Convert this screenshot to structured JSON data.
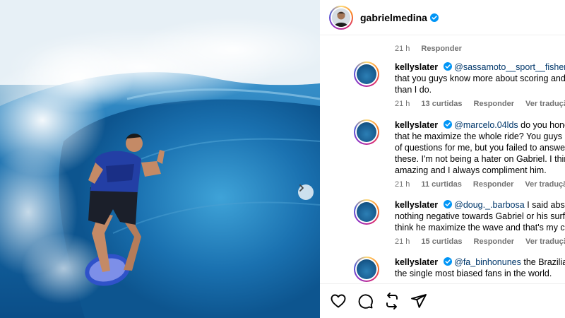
{
  "post": {
    "username": "gabrielmedina",
    "verified": true
  },
  "carousel": {
    "next_icon": "chevron-right-icon"
  },
  "top_comment_meta": {
    "time": "21 h",
    "reply": "Responder"
  },
  "comments": [
    {
      "username": "kellyslater",
      "mention": "@sassamoto__sport__fisherman",
      "lines_after_mention": "",
      "lines": [
        "that you guys know more about scoring and",
        "than I do."
      ],
      "time": "21 h",
      "likes": "13 curtidas",
      "reply": "Responder",
      "translate": "Ver tradução"
    },
    {
      "username": "kellyslater",
      "mention": "@marcelo.04lds",
      "lines_after_mention": "do you honest",
      "lines": [
        "that he maximize the whole ride? You guys h",
        "of questions for me, but you failed to answe",
        "these. I'm not being a hater on Gabriel. I thin",
        "amazing and I always compliment him."
      ],
      "time": "21 h",
      "likes": "11 curtidas",
      "reply": "Responder",
      "translate": "Ver tradução"
    },
    {
      "username": "kellyslater",
      "mention": "@doug._.barbosa",
      "lines_after_mention": "I said absolu",
      "lines": [
        "nothing negative towards Gabriel or his surfi",
        "think he maximize the wave and that's my co"
      ],
      "time": "21 h",
      "likes": "15 curtidas",
      "reply": "Responder",
      "translate": "Ver tradução"
    },
    {
      "username": "kellyslater",
      "mention": "@fa_binhonunes",
      "lines_after_mention": "the Brazilian f",
      "lines": [
        "the single most biased fans in the world."
      ],
      "time": "",
      "likes": "",
      "reply": "",
      "translate": ""
    }
  ],
  "actions": {
    "like_icon": "heart-icon",
    "comment_icon": "comment-icon",
    "share_icon": "repost-icon",
    "send_icon": "send-icon"
  },
  "colors": {
    "verified_blue": "#0095f6",
    "mention_blue": "#00376b",
    "meta_gray": "#737373",
    "ocean_blue": "#146aa9"
  }
}
